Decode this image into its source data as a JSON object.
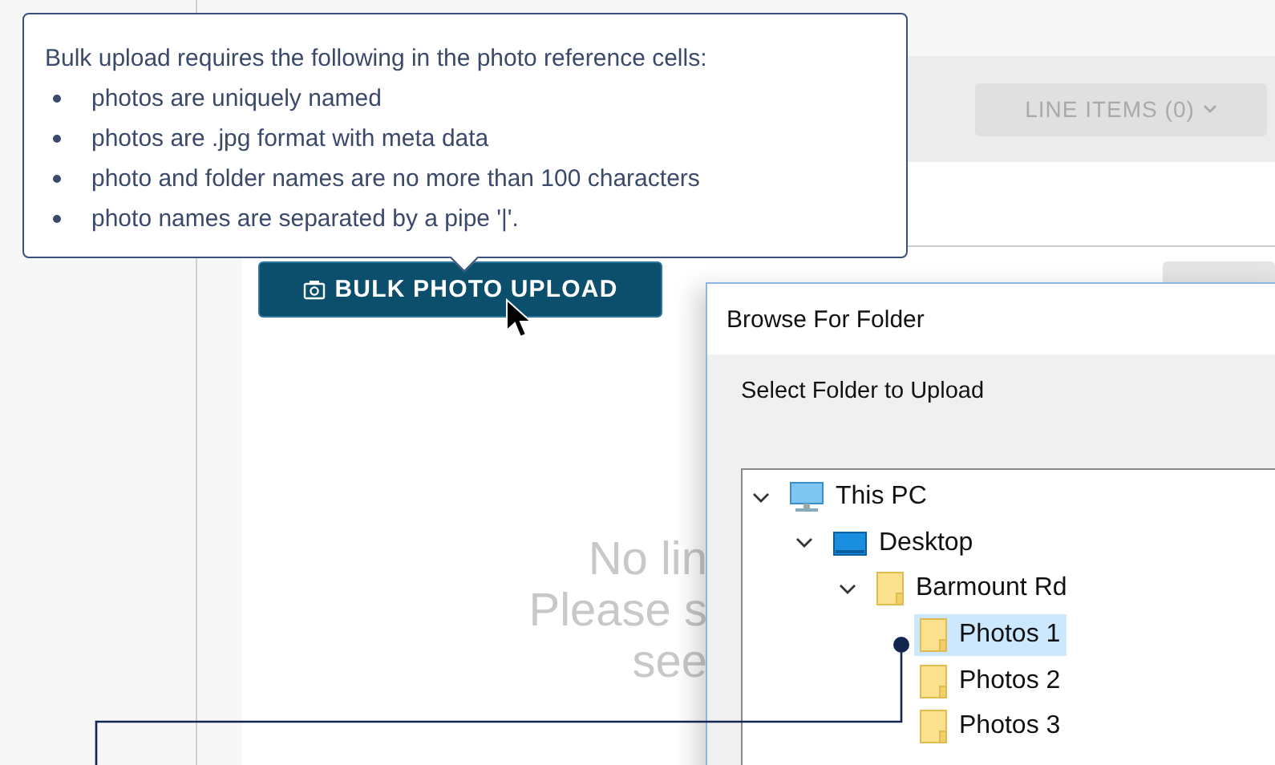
{
  "header": {
    "line_items_button": {
      "label": "LINE ITEMS (0)",
      "disabled": true
    }
  },
  "tooltip": {
    "intro": "Bulk upload requires the following in the photo reference cells:",
    "rules": [
      "photos are uniquely named",
      "photos are .jpg format with meta data",
      "photo and folder names are no more than 100 characters",
      "photo names are separated by a pipe '|'."
    ]
  },
  "bulk_upload_button": {
    "label": "BULK PHOTO UPLOAD"
  },
  "empty_message": [
    "No lin",
    "Please s",
    "see"
  ],
  "dialog": {
    "title": "Browse For Folder",
    "prompt": "Select Folder to Upload",
    "tree": [
      {
        "label": "This PC",
        "kind": "computer",
        "expanded": true,
        "selected": false,
        "children": [
          {
            "label": "Desktop",
            "kind": "desktop",
            "expanded": true,
            "selected": false,
            "children": [
              {
                "label": "Barmount Rd",
                "kind": "folder",
                "expanded": true,
                "selected": false,
                "children": [
                  {
                    "label": "Photos 1",
                    "kind": "folder",
                    "selected": true
                  },
                  {
                    "label": "Photos 2",
                    "kind": "folder",
                    "selected": false
                  },
                  {
                    "label": "Photos 3",
                    "kind": "folder",
                    "selected": false
                  }
                ]
              }
            ]
          }
        ]
      }
    ]
  }
}
